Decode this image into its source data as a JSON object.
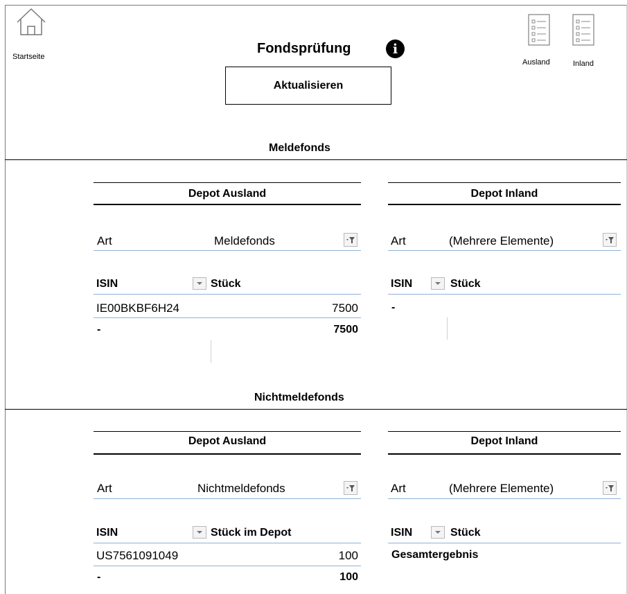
{
  "header": {
    "home_label": "Startseite",
    "title": "Fondsprüfung",
    "refresh_label": "Aktualisieren",
    "list_ausland_label": "Ausland",
    "list_inland_label": "Inland"
  },
  "meldefonds": {
    "section_title": "Meldefonds",
    "ausland": {
      "title": "Depot Ausland",
      "filter_label": "Art",
      "filter_value": "Meldefonds",
      "col_isin": "ISIN",
      "col_qty": "Stück",
      "rows": [
        {
          "isin": "IE00BKBF6H24",
          "qty": "7500"
        }
      ],
      "total_label": "-",
      "total_value": "7500"
    },
    "inland": {
      "title": "Depot Inland",
      "filter_label": "Art",
      "filter_value": "(Mehrere Elemente)",
      "col_isin": "ISIN",
      "col_qty": "Stück",
      "total_label": "-"
    }
  },
  "nichtmeldefonds": {
    "section_title": "Nichtmeldefonds",
    "ausland": {
      "title": "Depot Ausland",
      "filter_label": "Art",
      "filter_value": "Nichtmeldefonds",
      "col_isin": "ISIN",
      "col_qty": "Stück im Depot",
      "rows": [
        {
          "isin": "US7561091049",
          "qty": "100"
        }
      ],
      "total_label": "-",
      "total_value": "100"
    },
    "inland": {
      "title": "Depot Inland",
      "filter_label": "Art",
      "filter_value": "(Mehrere Elemente)",
      "col_isin": "ISIN",
      "col_qty": "Stück",
      "total_label": "Gesamtergebnis"
    }
  },
  "icons": {
    "home": "home-icon",
    "info": "info-icon",
    "list": "list-icon",
    "filter": "filter-icon",
    "dropdown": "dropdown-arrow-icon"
  }
}
